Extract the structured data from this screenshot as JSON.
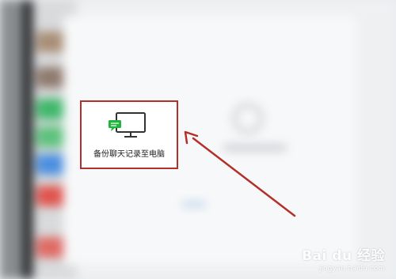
{
  "backup_option": {
    "label": "备份聊天记录至电脑",
    "icon": "monitor-chat-icon"
  },
  "colors": {
    "highlight": "#b3302a",
    "arrow": "#b3302a",
    "icon_green": "#23b33f"
  },
  "watermark": {
    "brand": "Bai du 经验",
    "url": "jingyan.baidu.com"
  }
}
